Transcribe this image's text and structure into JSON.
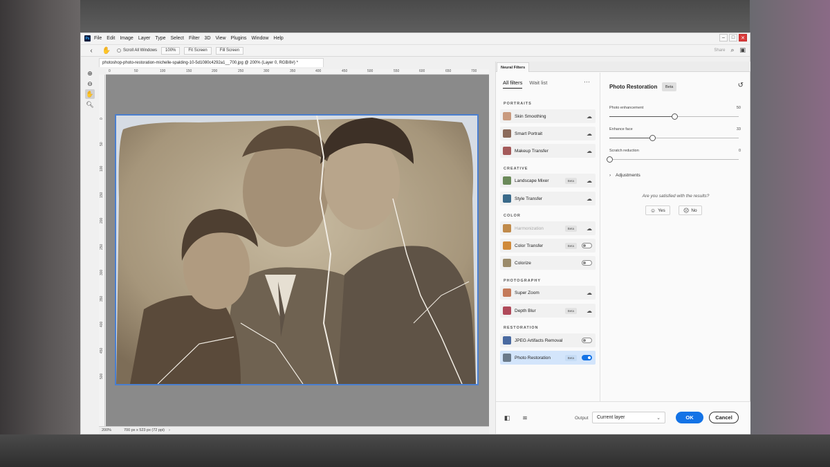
{
  "menubar": {
    "items": [
      "File",
      "Edit",
      "Image",
      "Layer",
      "Type",
      "Select",
      "Filter",
      "3D",
      "View",
      "Plugins",
      "Window",
      "Help"
    ]
  },
  "optionsbar": {
    "scroll_all_windows": "Scroll All Windows",
    "zoom_100": "100%",
    "fit_screen": "Fit Screen",
    "fill_screen": "Fill Screen",
    "share": "Share"
  },
  "document": {
    "tab_title": "photoshop-photo-restoration-michelle-spalding-10-5d1080c4292a1__700.jpg @ 200% (Layer 0, RGB/8#) *",
    "ruler_ticks_h": [
      "0",
      "50",
      "100",
      "150",
      "200",
      "250",
      "300",
      "350",
      "400",
      "450",
      "500",
      "550",
      "600",
      "650",
      "700"
    ],
    "ruler_ticks_v": [
      "0",
      "50",
      "100",
      "150",
      "200",
      "250",
      "300",
      "350",
      "400",
      "450",
      "500"
    ],
    "status_zoom": "200%",
    "status_info": "700 px x 523 px (72 ppi)"
  },
  "neural_filters": {
    "panel_tab": "Neural Filters",
    "tabs": {
      "all": "All filters",
      "waitlist": "Wait list"
    },
    "sections": {
      "portraits": "PORTRAITS",
      "creative": "CREATIVE",
      "color": "COLOR",
      "photography": "PHOTOGRAPHY",
      "restoration": "RESTORATION"
    },
    "filters": [
      {
        "label": "Skin Smoothing",
        "badge": "",
        "control": "cloud"
      },
      {
        "label": "Smart Portrait",
        "badge": "",
        "control": "cloud"
      },
      {
        "label": "Makeup Transfer",
        "badge": "",
        "control": "cloud"
      },
      {
        "label": "Landscape Mixer",
        "badge": "Beta",
        "control": "cloud"
      },
      {
        "label": "Style Transfer",
        "badge": "",
        "control": "cloud"
      },
      {
        "label": "Harmonization",
        "badge": "Beta",
        "control": "cloud"
      },
      {
        "label": "Color Transfer",
        "badge": "Beta",
        "control": "toggle-off"
      },
      {
        "label": "Colorize",
        "badge": "",
        "control": "toggle-off"
      },
      {
        "label": "Super Zoom",
        "badge": "",
        "control": "cloud"
      },
      {
        "label": "Depth Blur",
        "badge": "Beta",
        "control": "cloud"
      },
      {
        "label": "JPEG Artifacts Removal",
        "badge": "",
        "control": "toggle-off"
      },
      {
        "label": "Photo Restoration",
        "badge": "Beta",
        "control": "toggle-on"
      }
    ],
    "detail": {
      "title": "Photo Restoration",
      "badge": "Beta",
      "sliders": [
        {
          "label": "Photo enhancement",
          "value": 50
        },
        {
          "label": "Enhance face",
          "value": 33
        },
        {
          "label": "Scratch reduction",
          "value": 0
        }
      ],
      "adjustments": "Adjustments",
      "question": "Are you satisfied with the results?",
      "yes": "Yes",
      "no": "No"
    },
    "footer": {
      "output_label": "Output",
      "output_value": "Current layer",
      "ok": "OK",
      "cancel": "Cancel"
    }
  },
  "colors": {
    "accent": "#1473e6",
    "selection": "#d3e5fb",
    "canvas": "#8a8a8a"
  },
  "icons": [
    "zoom-in-icon",
    "zoom-out-icon",
    "hand-icon",
    "magnifier-icon",
    "back-icon",
    "search-icon",
    "panel-layout-icon",
    "cloud-download-icon",
    "reset-icon",
    "chevron-right-icon",
    "smile-icon",
    "frown-icon",
    "compare-icon",
    "layers-icon"
  ]
}
